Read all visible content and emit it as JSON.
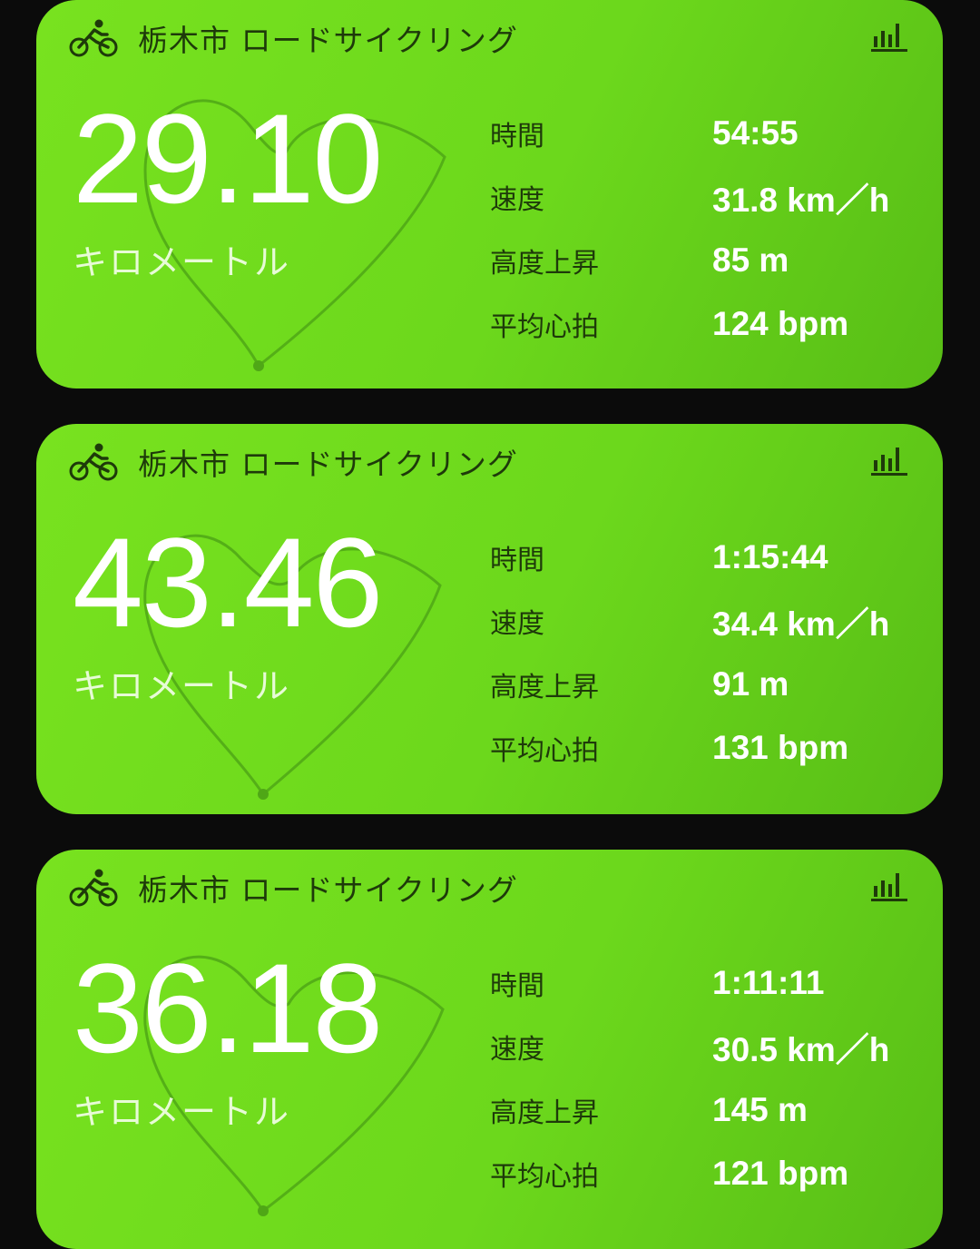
{
  "activities": [
    {
      "title": "栃木市 ロードサイクリング",
      "distance": "29.10",
      "distance_unit": "キロメートル",
      "stats": [
        {
          "label": "時間",
          "value": "54:55"
        },
        {
          "label": "速度",
          "value": "31.8 km／h"
        },
        {
          "label": "高度上昇",
          "value": "85 m"
        },
        {
          "label": "平均心拍",
          "value": "124 bpm"
        }
      ]
    },
    {
      "title": "栃木市 ロードサイクリング",
      "distance": "43.46",
      "distance_unit": "キロメートル",
      "stats": [
        {
          "label": "時間",
          "value": "1:15:44"
        },
        {
          "label": "速度",
          "value": "34.4 km／h"
        },
        {
          "label": "高度上昇",
          "value": "91 m"
        },
        {
          "label": "平均心拍",
          "value": "131 bpm"
        }
      ]
    },
    {
      "title": "栃木市 ロードサイクリング",
      "distance": "36.18",
      "distance_unit": "キロメートル",
      "stats": [
        {
          "label": "時間",
          "value": "1:11:11"
        },
        {
          "label": "速度",
          "value": "30.5 km／h"
        },
        {
          "label": "高度上昇",
          "value": "145 m"
        },
        {
          "label": "平均心拍",
          "value": "121 bpm"
        }
      ]
    }
  ],
  "icons": {
    "activity_type": "cycling-icon",
    "details": "bar-chart-icon"
  },
  "colors": {
    "card_gradient_start": "#78e21f",
    "card_gradient_end": "#58be16",
    "label_text": "#1e3a0a",
    "value_text": "#ffffff",
    "background": "#0b0b0b"
  }
}
